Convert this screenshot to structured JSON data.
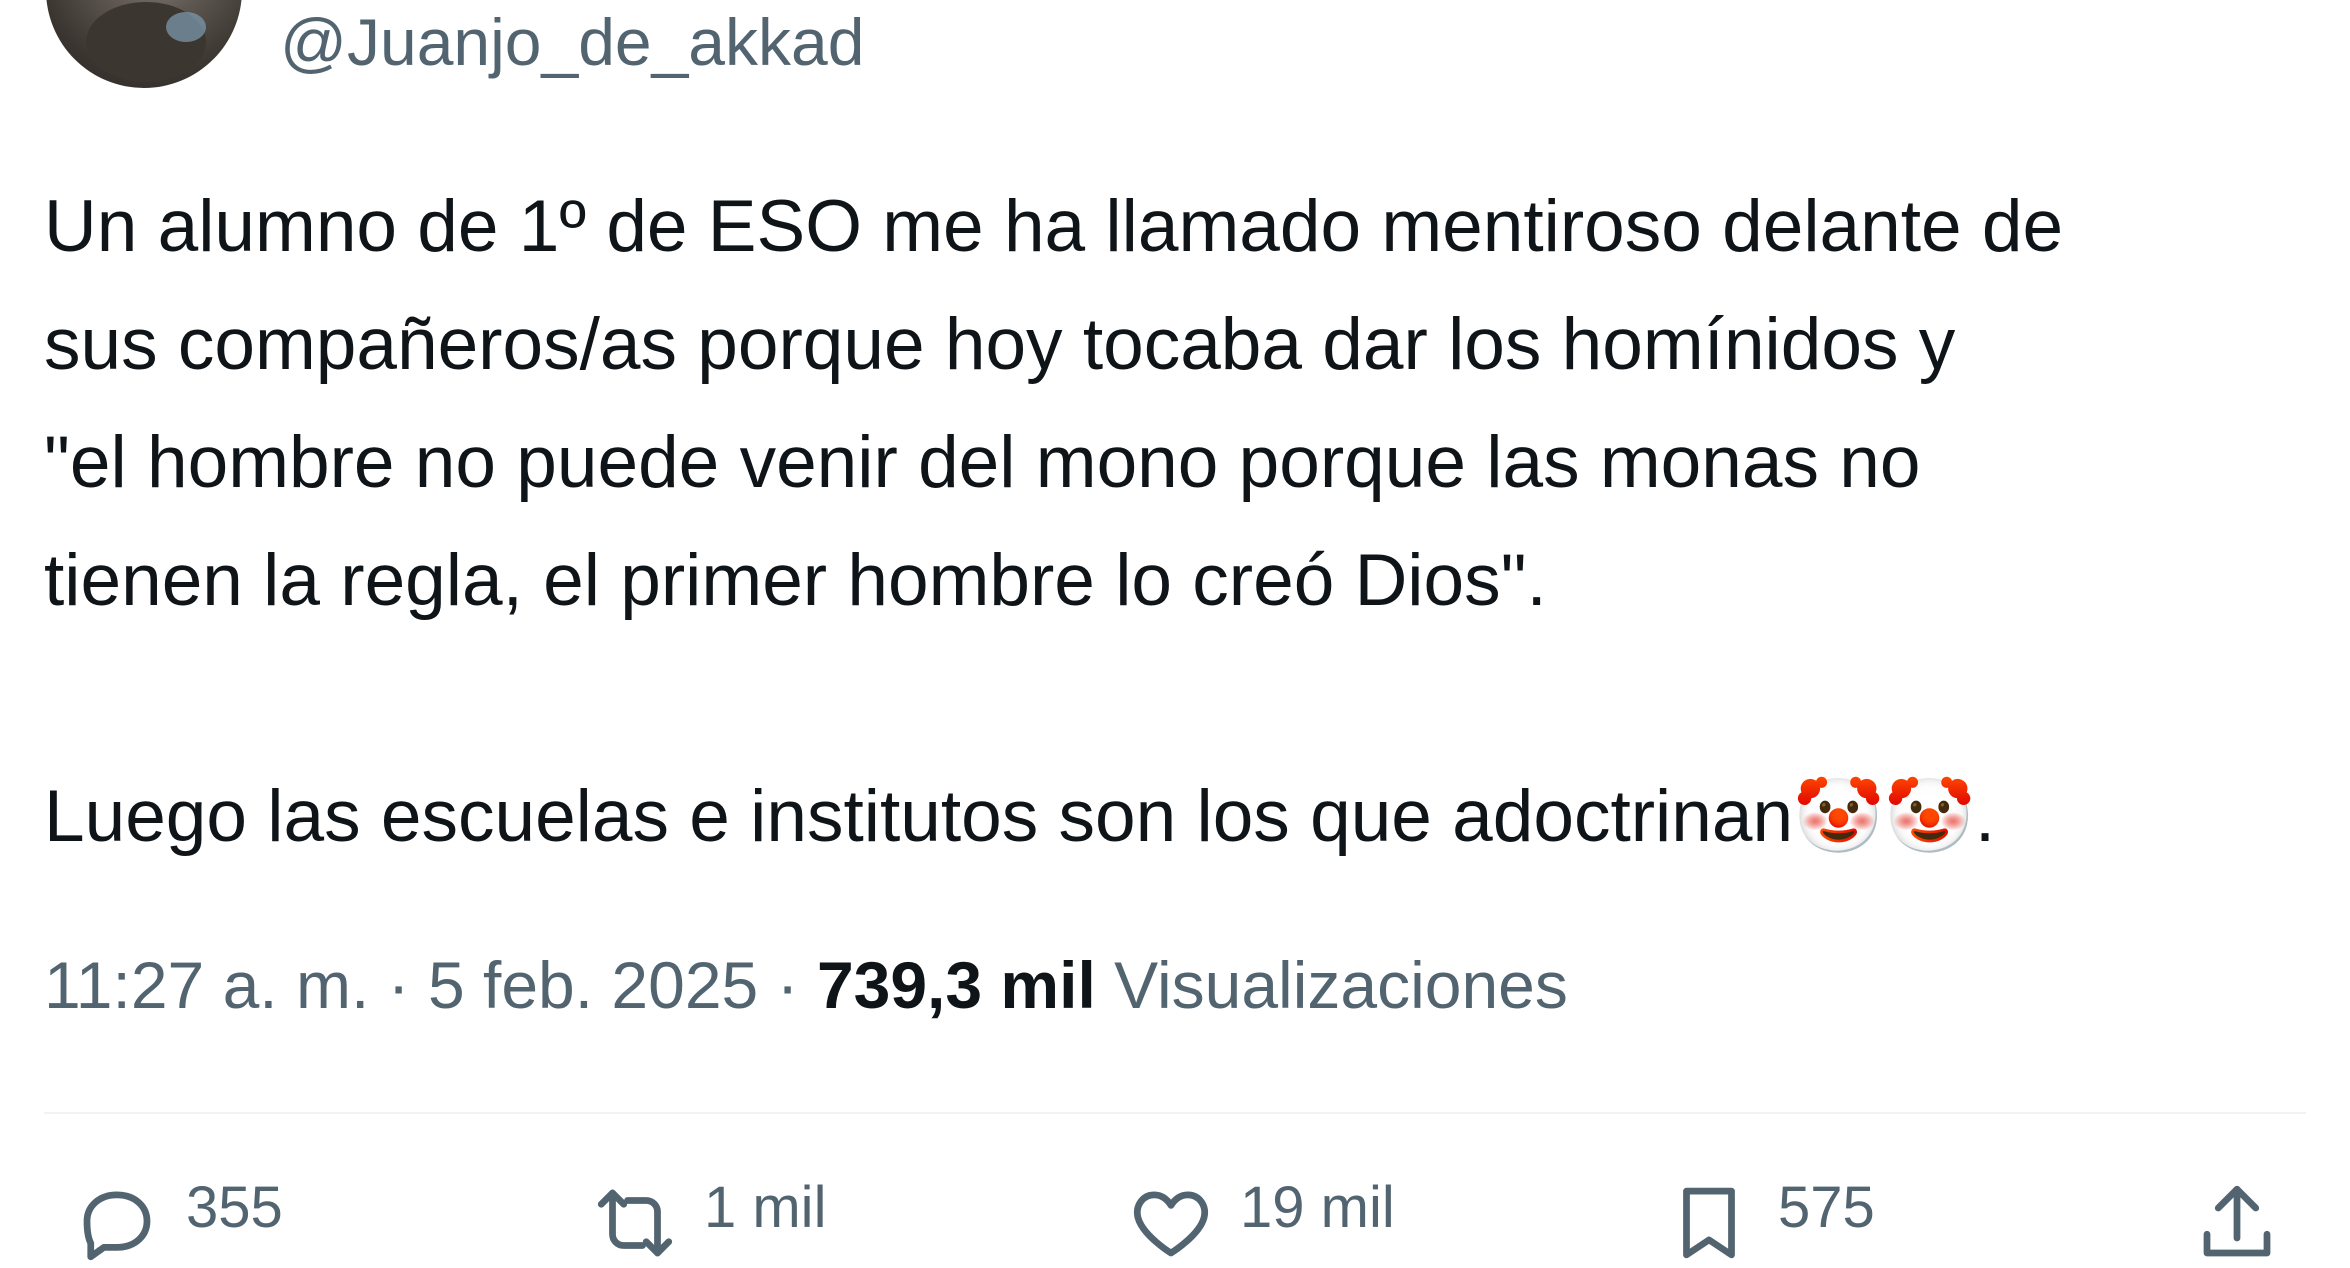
{
  "tweet": {
    "handle": "@Juanjo_de_akkad",
    "text_lines": [
      "Un alumno de 1º de ESO me ha llamado mentiroso delante de",
      "sus compañeros/as porque hoy tocaba dar los homínidos y",
      "\"el hombre no puede venir del mono porque las monas no",
      "tienen la regla, el primer hombre lo creó Dios\"."
    ],
    "text_line_2_prefix": "Luego las escuelas e institutos son los que adoctrinan",
    "text_line_2_emojis": "🤡🤡",
    "text_line_2_suffix": ".",
    "time": "11:27 a. m.",
    "separator": "·",
    "date": "5 feb. 2025",
    "views_count": "739,3 mil",
    "views_label": "Visualizaciones"
  },
  "actions": {
    "reply": {
      "icon": "reply-icon",
      "count": "355"
    },
    "retweet": {
      "icon": "retweet-icon",
      "count": "1 mil"
    },
    "like": {
      "icon": "heart-icon",
      "count": "19 mil"
    },
    "bookmark": {
      "icon": "bookmark-icon",
      "count": "575"
    },
    "share": {
      "icon": "share-icon"
    }
  },
  "colors": {
    "text": "#0f1419",
    "secondary": "#536471",
    "divider": "#eff3f4"
  }
}
